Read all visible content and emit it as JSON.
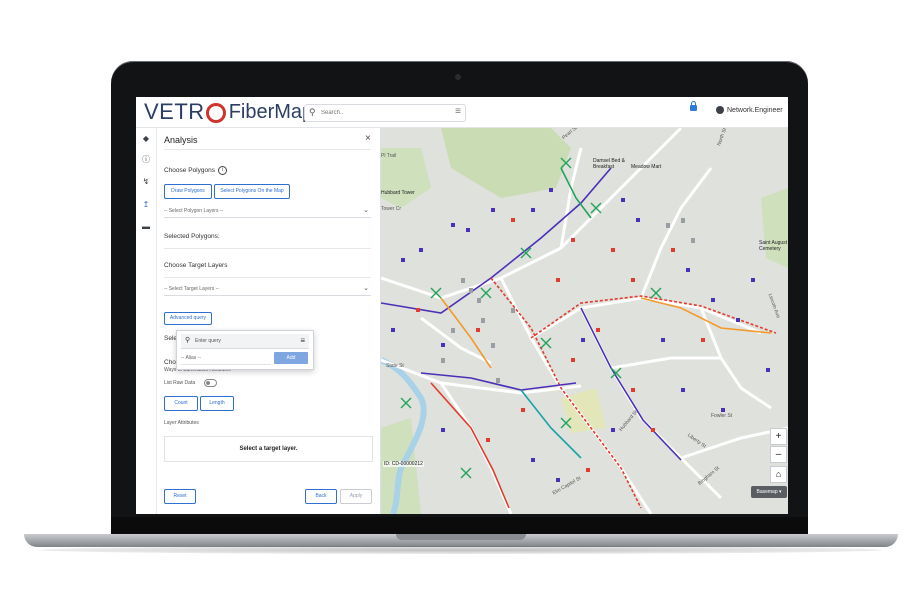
{
  "app": {
    "logo_vetro": "VETR",
    "logo_fiber": "FiberMap",
    "logo_reg": "®",
    "search_placeholder": "Search..",
    "user_name": "Network.Engineer"
  },
  "panel": {
    "title": "Analysis",
    "close": "×",
    "choose_polygons": "Choose Polygons",
    "info": "i",
    "draw_polygons": "Draw Polygons",
    "select_on_map": "Select Polygons On the Map",
    "select_polygon_layers": "-- Select Polygon Layers --",
    "selected_polygons": "Selected Polygons:",
    "choose_target_layers": "Choose Target Layers",
    "select_target_layers": "-- Select Target Layers --",
    "advanced_query": "Advanced query",
    "select_partial": "Select",
    "choose_partial": "Choo",
    "ways_to_summarize": "Ways to Summarize Attributes",
    "list_raw_data": "List Raw Data",
    "count": "Count",
    "length": "Length",
    "layer_attributes": "Layer Attributes",
    "select_target_layer": "Select a target layer.",
    "reset": "Reset",
    "back": "Back",
    "apply": "Apply"
  },
  "popup": {
    "query_placeholder": "Enter query",
    "alias": "-- Alias --",
    "add": "Add"
  },
  "map": {
    "id_label": "ID: CD-00000212",
    "basemap": "Basemap ▾",
    "zoom_in": "+",
    "zoom_out": "–",
    "home": "⌂",
    "streets": {
      "state_st": "State St",
      "hubbard_st": "Hubbard St",
      "fowler_st": "Fowler St",
      "liberty_st": "Liberty St",
      "bingham_st": "Bingham St",
      "north_st": "North St",
      "pearl_st": "Pearl St",
      "lincoln_ave": "Lincoln Ave",
      "elm_capitol": "Elm Capitol St",
      "tower_cr": "Tower Cr",
      "hubbard_tower": "Hubbard Tower",
      "pl_trail": "Pl Trail",
      "damsel_bnb": "Damsel Bed & Breakfast",
      "meadow_mart": "Meadow Mart",
      "saint_augustine": "Saint August Cemetery"
    }
  },
  "colors": {
    "brand_navy": "#2c3e66",
    "brand_red": "#d0342c",
    "accent_blue": "#2f6fcf",
    "fiber_red": "#e23a2e",
    "fiber_orange": "#f29a2c",
    "fiber_green": "#22a35a",
    "fiber_purple": "#4b2fb8",
    "fiber_teal": "#1aa1a6"
  }
}
